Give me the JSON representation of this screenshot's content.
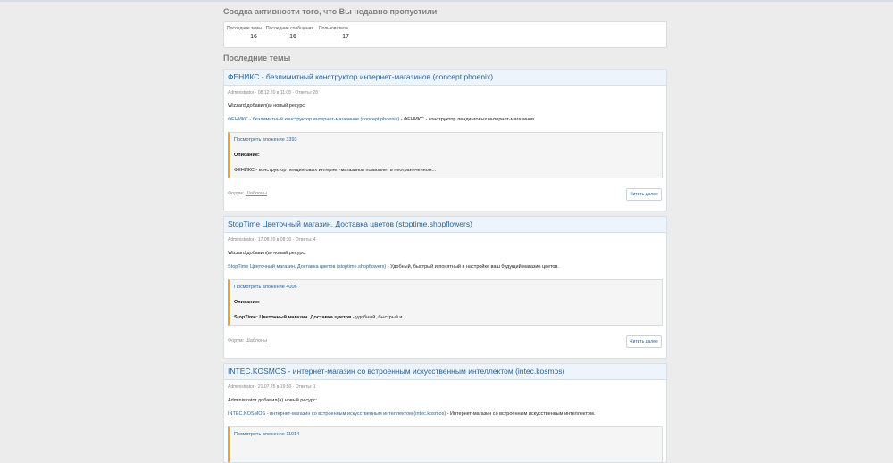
{
  "summary": {
    "title": "Сводка активности того, что Вы недавно пропустили",
    "stats": [
      {
        "label": "Последние темы",
        "value": "16"
      },
      {
        "label": "Последние сообщения",
        "value": "16"
      },
      {
        "label": "Пользователи",
        "value": "17"
      }
    ]
  },
  "recent": {
    "title": "Последние темы",
    "forum_label": "Форум:",
    "read_more": "Читать далее",
    "description_label": "Описание:",
    "posts": [
      {
        "title": "ФЕНИКС - безлимитный конструктор интернет-магазинов (concept.phoenix)",
        "meta": "Administrator · 08.12.20 в 11:08 · Ответы: 28",
        "added": "Wizzard добавил(а) новый ресурс:",
        "resource_link": "ФЕНИКС - безлимитный конструктор интернет-магазинов (concept.phoenix)",
        "resource_desc": " - ФЕНИКС - конструктор лендинговых интернет-магазинов.",
        "attachment": "Посмотреть вложение 3393",
        "quote_bold": "",
        "quote_text": "ФЕНИКС - конструктор лендинговых интернет-магазинов позволяет в неограниченном...",
        "forum": "Шаблоны"
      },
      {
        "title": "StopTime Цветочный магазин. Доставка цветов (stoptime.shopflowers)",
        "meta": "Administrator · 17.08.20 в 08:30 · Ответы: 4",
        "added": "Wizzard добавил(а) новый ресурс:",
        "resource_link": "StopTime Цветочный магазин. Доставка цветов (stoptime.shopflowers)",
        "resource_desc": " - Удобный, быстрый и понятный в настройке ваш будущий магазин цветов.",
        "attachment": "Посмотреть вложение 4006",
        "quote_bold": "StopTime: Цветочный магазин. Доставка цветов",
        "quote_text": " - удобный, быстрый и...",
        "forum": "Шаблоны"
      },
      {
        "title": "INTEC.KOSMOS - интернет-магазин со встроенным искусственным интеллектом (intec.kosmos)",
        "meta": "Administrator · 21.07.25 в 19:50 · Ответы: 1",
        "added": "Administrator добавил(а) новый ресурс:",
        "resource_link": "INTEC.KOSMOS - интернет-магазин со встроенным искусственным интеллектом (intec.kosmos)",
        "resource_desc": " - Интернет-магазин со встроенным искусственным интеллектом.",
        "attachment": "Посмотреть вложение 11014",
        "quote_bold": "",
        "quote_text": "",
        "forum": ""
      }
    ]
  }
}
